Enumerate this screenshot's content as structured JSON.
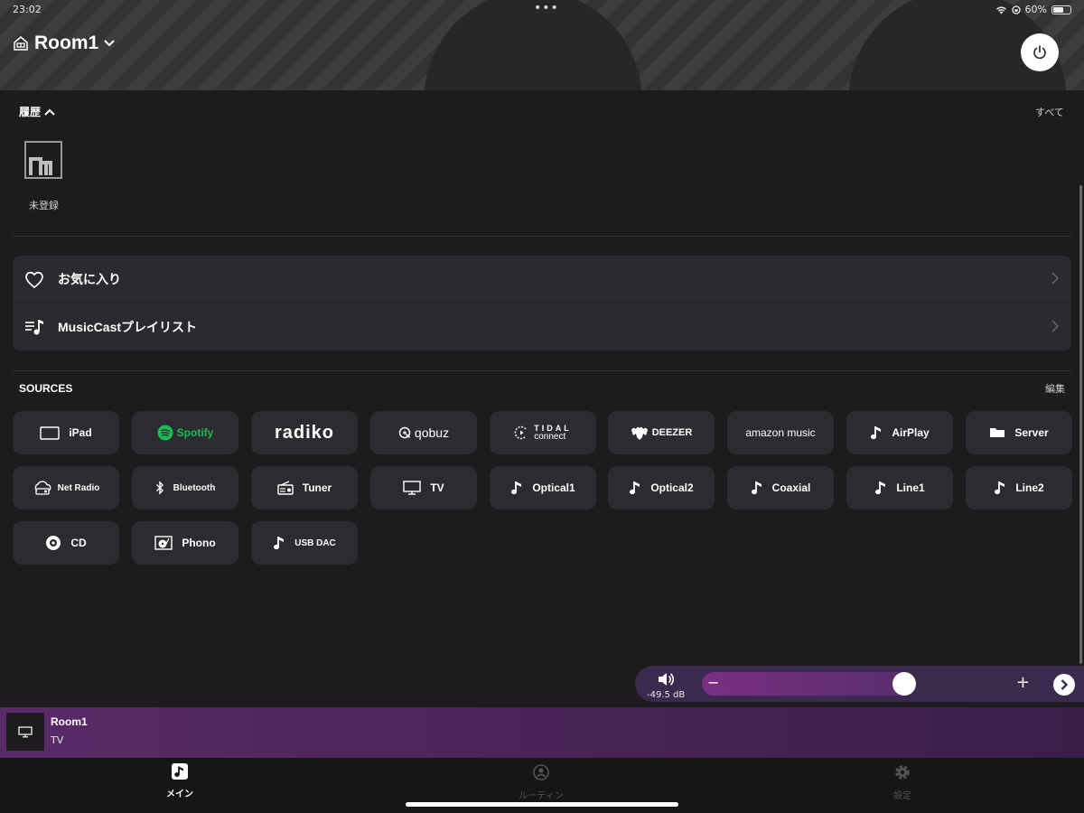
{
  "status": {
    "time": "23:02",
    "battery": "60%"
  },
  "header": {
    "room_name": "Room1"
  },
  "history": {
    "title": "履歴",
    "all_label": "すべて",
    "items": [
      {
        "label": "未登録"
      }
    ]
  },
  "favorites": {
    "items": [
      {
        "label": "お気に入り",
        "icon": "heart-icon"
      },
      {
        "label": "MusicCastプレイリスト",
        "icon": "playlist-icon"
      }
    ]
  },
  "sources": {
    "title": "SOURCES",
    "edit_label": "編集",
    "items": [
      {
        "label": "iPad",
        "icon": "tablet-icon"
      },
      {
        "label": "Spotify",
        "icon": "spotify-logo",
        "color": "#1db954"
      },
      {
        "label": "radiko",
        "icon": "radiko-logo"
      },
      {
        "label": "qobuz",
        "icon": "qobuz-logo"
      },
      {
        "label": "TIDAL",
        "sublabel": "connect",
        "icon": "tidal-logo"
      },
      {
        "label": "DEEZER",
        "icon": "deezer-logo"
      },
      {
        "label": "amazon music",
        "icon": "amazon-music-logo"
      },
      {
        "label": "AirPlay",
        "icon": "music-note-icon"
      },
      {
        "label": "Server",
        "icon": "server-icon"
      },
      {
        "label": "Net Radio",
        "icon": "net-radio-icon"
      },
      {
        "label": "Bluetooth",
        "icon": "bluetooth-icon"
      },
      {
        "label": "Tuner",
        "icon": "radio-icon"
      },
      {
        "label": "TV",
        "icon": "tv-icon"
      },
      {
        "label": "Optical1",
        "icon": "music-note-icon"
      },
      {
        "label": "Optical2",
        "icon": "music-note-icon"
      },
      {
        "label": "Coaxial",
        "icon": "music-note-icon"
      },
      {
        "label": "Line1",
        "icon": "music-note-icon"
      },
      {
        "label": "Line2",
        "icon": "music-note-icon"
      },
      {
        "label": "CD",
        "icon": "cd-icon"
      },
      {
        "label": "Phono",
        "icon": "turntable-icon"
      },
      {
        "label": "USB DAC",
        "icon": "music-note-icon"
      }
    ]
  },
  "volume": {
    "db": "-49.5 dB",
    "level": 0.6,
    "minus": "−",
    "plus": "+"
  },
  "now_playing": {
    "room": "Room1",
    "source": "TV"
  },
  "tabs": [
    {
      "label": "メイン",
      "active": true
    },
    {
      "label": "ルーティン",
      "active": false
    },
    {
      "label": "設定",
      "active": false
    }
  ]
}
